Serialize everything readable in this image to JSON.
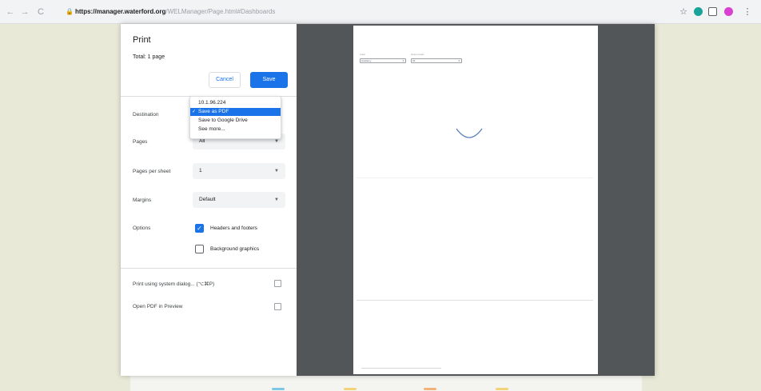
{
  "browser": {
    "nav": {
      "back": "←",
      "forward": "→",
      "reload": "C"
    },
    "url_host": "https://manager.waterford.org",
    "url_path": "/WELManager/Page.html#Dashboards"
  },
  "print_dialog": {
    "title": "Print",
    "total": "Total: 1 page",
    "cancel_label": "Cancel",
    "save_label": "Save",
    "destination": {
      "label": "Destination",
      "options": [
        {
          "label": "10.1.96.224",
          "selected": false
        },
        {
          "label": "Save as PDF",
          "selected": true
        },
        {
          "label": "Save to Google Drive",
          "selected": false
        },
        {
          "label": "See more...",
          "selected": false
        }
      ]
    },
    "pages": {
      "label": "Pages",
      "value": "All"
    },
    "pages_per_sheet": {
      "label": "Pages per sheet",
      "value": "1"
    },
    "margins": {
      "label": "Margins",
      "value": "Default"
    },
    "options": {
      "label": "Options",
      "headers_footers": {
        "label": "Headers and footers",
        "checked": true
      },
      "background_graphics": {
        "label": "Background graphics",
        "checked": false
      }
    },
    "system_dialog": "Print using system dialog... (⌥⌘P)",
    "open_pdf_preview": "Open PDF in Preview"
  },
  "preview": {
    "filter1": {
      "label": "Grade",
      "value": "Academy"
    },
    "filter2": {
      "label": "Student Grade",
      "value": "All"
    }
  },
  "colors": {
    "accent": "#1a73e8",
    "preview_bg": "#525659",
    "page_bg": "#e9e9d7"
  },
  "icons": [
    "back-icon",
    "forward-icon",
    "reload-icon",
    "lock-icon",
    "star-icon",
    "chevron-down-icon",
    "checkmark-icon",
    "open-external-icon",
    "spinner-icon"
  ]
}
